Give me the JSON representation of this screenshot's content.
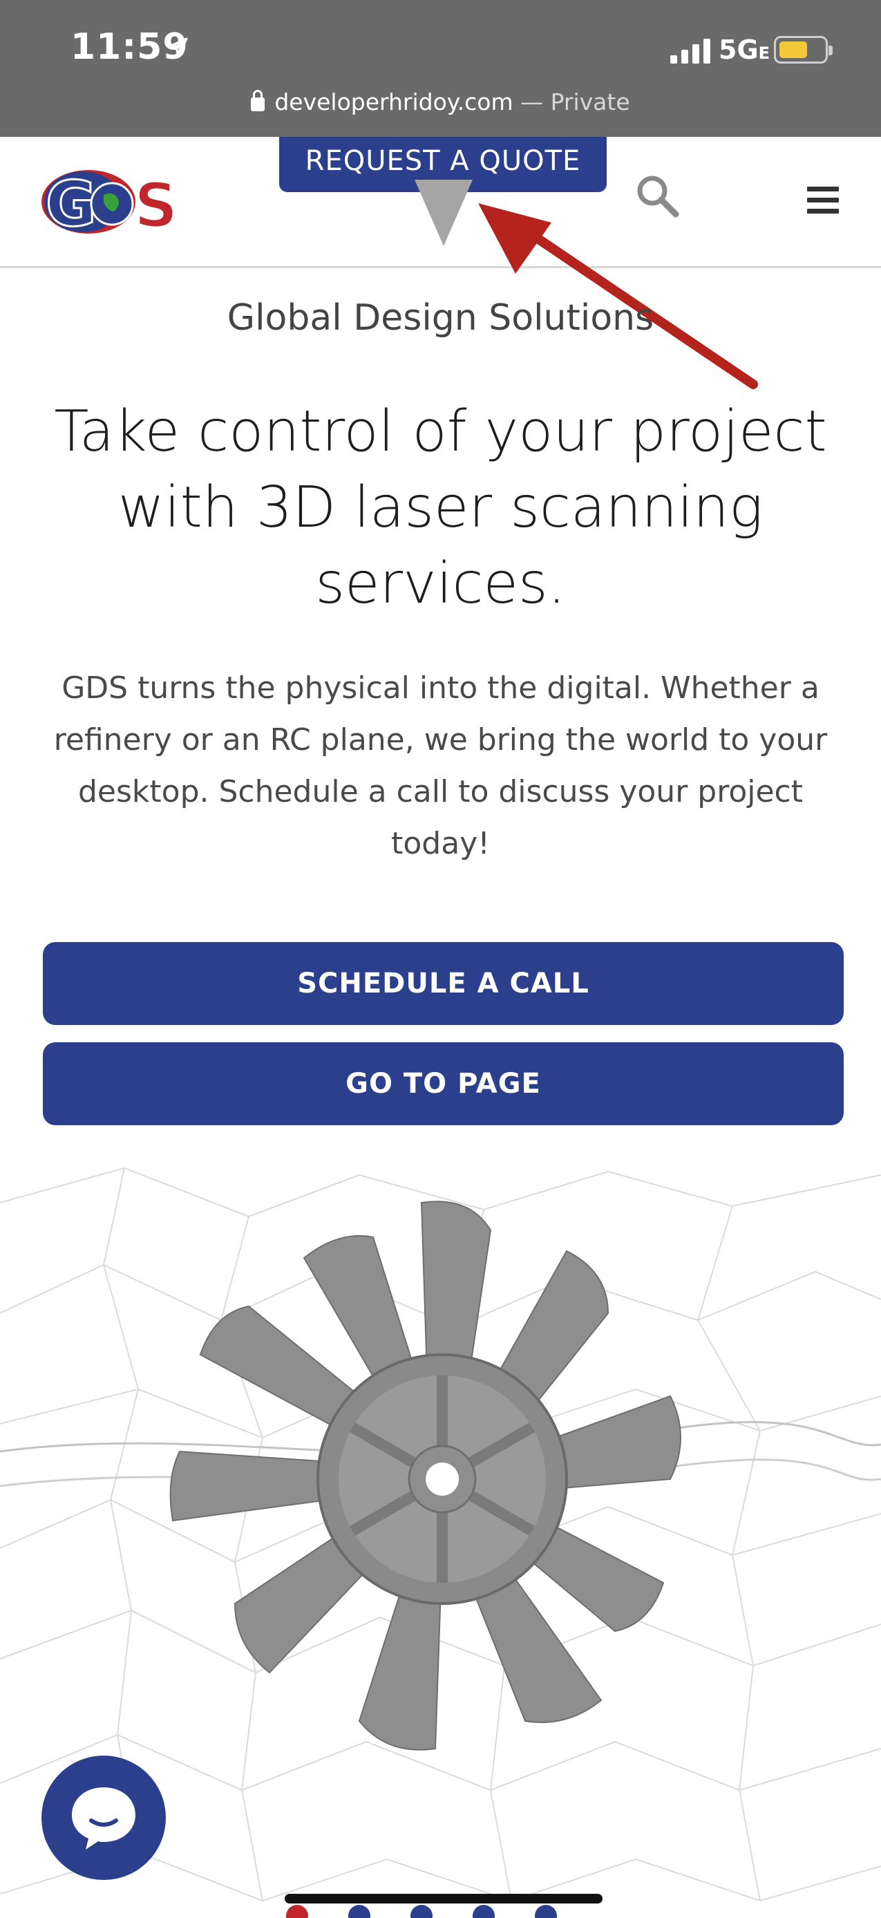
{
  "status_bar": {
    "time": "11:59",
    "network": "5G",
    "network_suffix": "E",
    "url": "developerhridoy.com",
    "url_separator": "—",
    "mode": "Private",
    "battery_color": "#f2c838"
  },
  "header": {
    "logo_text": "GDS",
    "request_quote_label": "REQUEST A QUOTE",
    "icons": [
      "search-icon",
      "menu-icon"
    ]
  },
  "hero": {
    "tagline": "Global Design Solutions",
    "headline": "Take control of your project with 3D laser scanning services.",
    "description": "GDS turns the physical into the digital. Whether a refinery or an RC plane, we bring the world to your desktop. Schedule a call to discuss your project today!",
    "schedule_button": "SCHEDULE A CALL",
    "page_button": "GO TO PAGE",
    "image": "3D scanned fan model"
  },
  "carousel": {
    "total_slides": 5,
    "active_slide": 1
  },
  "colors": {
    "brand_blue": "#2b3f8c",
    "brand_red": "#c0272d",
    "status_bar": "#6a6a6a",
    "annotation_arrow": "#b5231d"
  }
}
